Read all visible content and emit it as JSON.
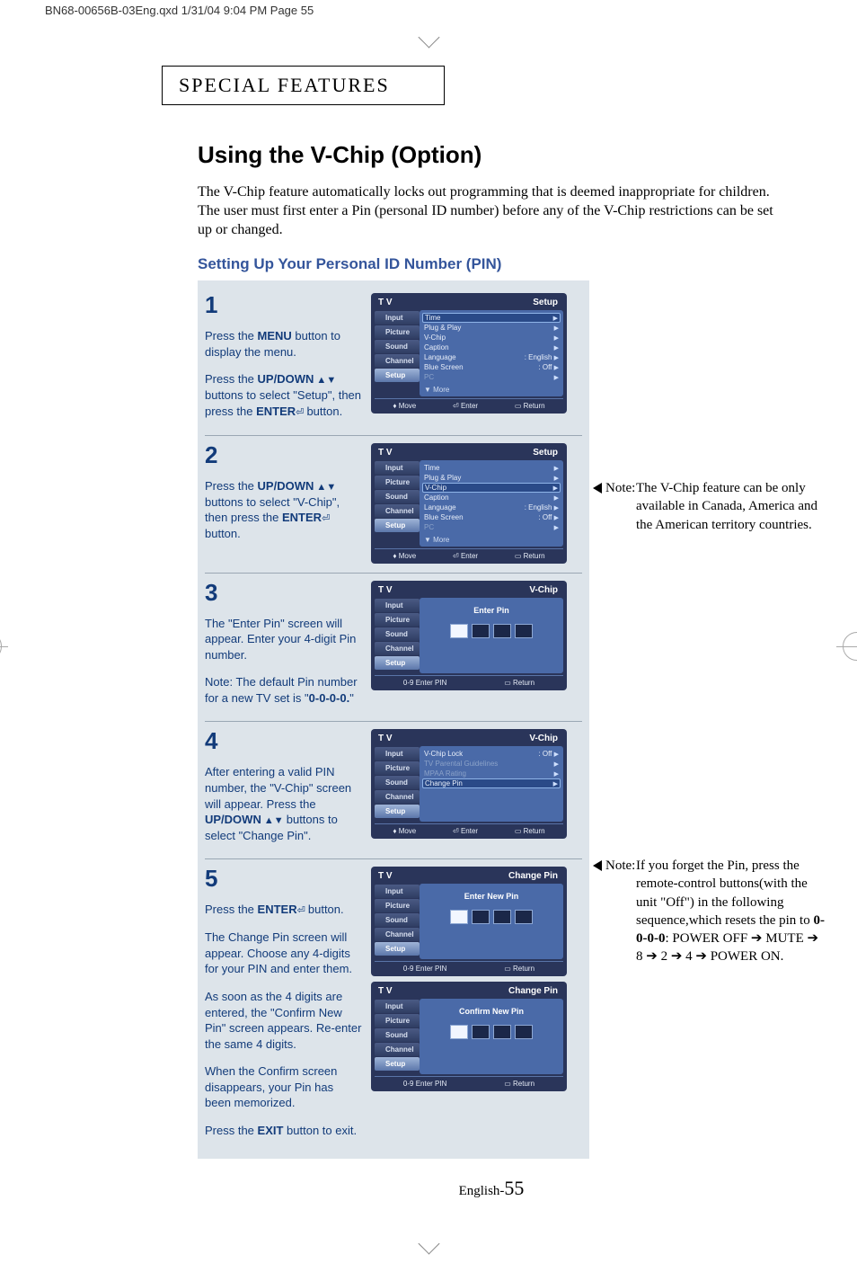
{
  "print_header": "BN68-00656B-03Eng.qxd  1/31/04  9:04 PM  Page 55",
  "section_header": "SPECIAL FEATURES",
  "title": "Using the V-Chip (Option)",
  "intro": "The V-Chip feature automatically locks out programming that is deemed inappropriate for children. The user must first enter a Pin (personal ID number) before any of the V-Chip restrictions can be set up or changed.",
  "subheading": "Setting Up Your Personal ID Number (PIN)",
  "steps": {
    "s1": {
      "num": "1",
      "p1a": "Press the ",
      "p1b": "MENU",
      "p1c": " button to display the menu.",
      "p2a": "Press the ",
      "p2b": "UP/DOWN",
      "p2c": " buttons to select \"Setup\", then press the ",
      "p2d": "ENTER",
      "p2e": " button."
    },
    "s2": {
      "num": "2",
      "p1a": "Press the ",
      "p1b": "UP/DOWN",
      "p1c": " buttons to select \"V-Chip\", then press the ",
      "p1d": "ENTER",
      "p1e": " button."
    },
    "s3": {
      "num": "3",
      "p1": "The \"Enter Pin\" screen will appear. Enter your 4-digit Pin number.",
      "p2a": "Note: The default Pin number for a new TV set is \"",
      "p2b": "0-0-0-0.",
      "p2c": "\""
    },
    "s4": {
      "num": "4",
      "p1a": "After entering a valid PIN number, the \"V-Chip\" screen will appear. Press the ",
      "p1b": "UP/DOWN",
      "p1c": " buttons to select \"Change Pin\"."
    },
    "s5": {
      "num": "5",
      "p1a": "Press the ",
      "p1b": "ENTER",
      "p1c": " button.",
      "p2": "The Change Pin screen will appear. Choose any 4-digits for your PIN and enter them.",
      "p3": "As soon as the 4 digits are entered, the \"Confirm New Pin\" screen appears. Re-enter the same 4 digits.",
      "p4": "When the Confirm screen disappears, your Pin has been memorized.",
      "p5a": "Press the ",
      "p5b": "EXIT",
      "p5c": " button to exit."
    }
  },
  "screens": {
    "common": {
      "tv_label": "T V",
      "tabs": [
        "Input",
        "Picture",
        "Sound",
        "Channel",
        "Setup"
      ],
      "foot_move": "Move",
      "foot_enter": "Enter",
      "foot_return": "Return",
      "foot_pin": "0-9 Enter PIN"
    },
    "setup": {
      "title": "Setup",
      "items": [
        {
          "label": "Time",
          "val": "",
          "arrow": "▶"
        },
        {
          "label": "Plug & Play",
          "val": "",
          "arrow": "▶"
        },
        {
          "label": "V-Chip",
          "val": "",
          "arrow": "▶"
        },
        {
          "label": "Caption",
          "val": "",
          "arrow": "▶"
        },
        {
          "label": "Language",
          "val": ": English",
          "arrow": "▶"
        },
        {
          "label": "Blue Screen",
          "val": ": Off",
          "arrow": "▶"
        },
        {
          "label": "PC",
          "val": "",
          "arrow": "▶",
          "dim": true
        }
      ],
      "more": "▼ More"
    },
    "vchip_enter": {
      "title": "V-Chip",
      "center": "Enter Pin"
    },
    "vchip_menu": {
      "title": "V-Chip",
      "items": [
        {
          "label": "V-Chip Lock",
          "val": ": Off",
          "arrow": "▶"
        },
        {
          "label": "TV Parental Guidelines",
          "val": "",
          "arrow": "▶",
          "dim": true
        },
        {
          "label": "MPAA Rating",
          "val": "",
          "arrow": "▶",
          "dim": true
        },
        {
          "label": "Change Pin",
          "val": "",
          "arrow": "▶",
          "hl": true
        }
      ]
    },
    "change_pin": {
      "title": "Change Pin",
      "center": "Enter New Pin"
    },
    "confirm_pin": {
      "title": "Change Pin",
      "center": "Confirm New Pin"
    }
  },
  "notes": {
    "n1": {
      "label": "Note:",
      "text": "The V-Chip feature can be only available in Canada, America and the American territory countries."
    },
    "n2": {
      "label": "Note:",
      "text_a": "If you forget the Pin, press the remote-control buttons(with the unit \"Off\") in the following sequence,which resets the pin to ",
      "text_b": "0-0-0-0",
      "text_c": ": POWER OFF ➔ MUTE ➔ 8 ➔ 2 ➔ 4 ➔ POWER ON."
    }
  },
  "footer": {
    "lang": "English-",
    "page": "55"
  }
}
